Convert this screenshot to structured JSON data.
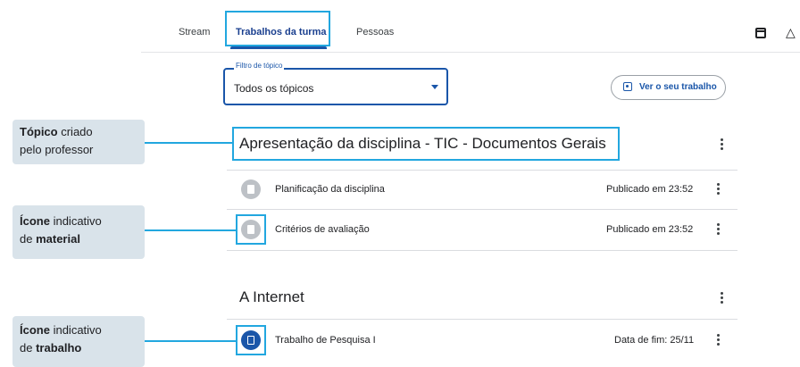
{
  "tabs": {
    "stream": "Stream",
    "classwork": "Trabalhos da turma",
    "people": "Pessoas"
  },
  "filter": {
    "label": "Filtro de tópico",
    "value": "Todos os tópicos"
  },
  "view_work_button": "Ver o seu trabalho",
  "callouts": {
    "topic": {
      "bold": "Tópico",
      "rest": " criado",
      "line2": "pelo professor"
    },
    "material": {
      "bold": "Ícone",
      "rest": " indicativo",
      "line2_prefix": "de ",
      "line2_bold": "material"
    },
    "assignment": {
      "bold": "Ícone",
      "rest": " indicativo",
      "line2_prefix": "de ",
      "line2_bold": "trabalho"
    }
  },
  "topics": [
    {
      "title": "Apresentação da disciplina - TIC - Documentos Gerais",
      "items": [
        {
          "title": "Planificação da disciplina",
          "meta": "Publicado em 23:52",
          "icon": "material-icon"
        },
        {
          "title": "Critérios de avaliação",
          "meta": "Publicado em 23:52",
          "icon": "material-icon"
        }
      ]
    },
    {
      "title": "A Internet",
      "items": [
        {
          "title": "Trabalho de Pesquisa I",
          "meta": "Data de fim: 25/11",
          "icon": "assignment-icon"
        }
      ]
    }
  ],
  "colors": {
    "accent": "#1a56a9",
    "highlight": "#22a7df",
    "callout_bg": "#d9e3ea"
  }
}
